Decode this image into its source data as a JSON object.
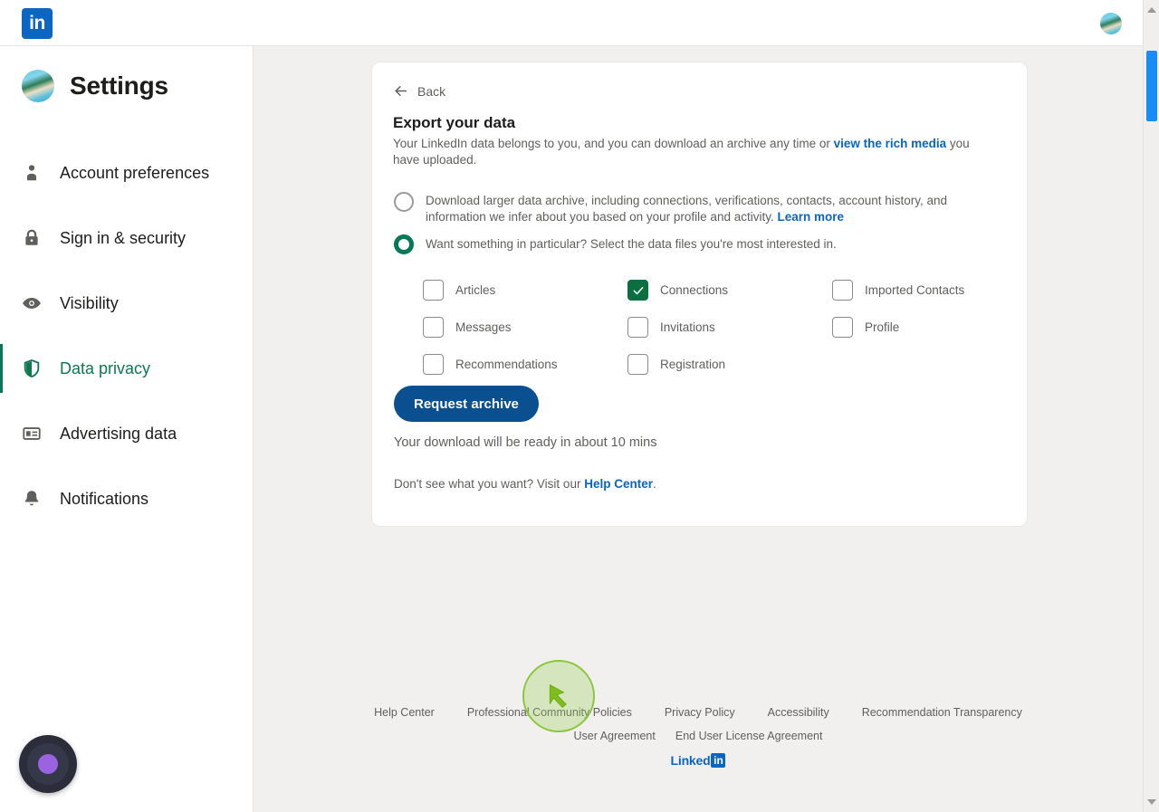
{
  "topbar": {
    "logo_text": "in",
    "logo_color": "#0a66c2",
    "avatar_name": "profile-avatar"
  },
  "sidebar": {
    "title": "Settings",
    "items": [
      {
        "label": "Account preferences",
        "icon": "person-icon",
        "active": false
      },
      {
        "label": "Sign in & security",
        "icon": "lock-icon",
        "active": false
      },
      {
        "label": "Visibility",
        "icon": "eye-icon",
        "active": false
      },
      {
        "label": "Data privacy",
        "icon": "shield-icon",
        "active": true
      },
      {
        "label": "Advertising data",
        "icon": "ad-card-icon",
        "active": false
      },
      {
        "label": "Notifications",
        "icon": "bell-icon",
        "active": false
      }
    ],
    "active_color": "#0a7a4e"
  },
  "card": {
    "back_label": "Back",
    "title": "Export your data",
    "description_part1": "Your LinkedIn data belongs to you, and you can download an archive any time or ",
    "description_link": "view the rich media",
    "description_part2": " you have uploaded.",
    "options": [
      {
        "id": "larger-archive",
        "selected": false,
        "text_part1": "Download larger data archive, including connections, verifications, contacts, account history, and information we infer about you based on your profile and activity. ",
        "link": "Learn more"
      },
      {
        "id": "specific-files",
        "selected": true,
        "text_part1": "Want something in particular? Select the data files you're most interested in.",
        "link": ""
      }
    ],
    "checkboxes": [
      {
        "label": "Articles",
        "checked": false
      },
      {
        "label": "Connections",
        "checked": true
      },
      {
        "label": "Imported Contacts",
        "checked": false
      },
      {
        "label": "Messages",
        "checked": false
      },
      {
        "label": "Invitations",
        "checked": false
      },
      {
        "label": "Profile",
        "checked": false
      },
      {
        "label": "Recommendations",
        "checked": false
      },
      {
        "label": "Registration",
        "checked": false
      }
    ],
    "request_button": "Request archive",
    "status_text": "Your download will be ready in about 10 mins",
    "help_prefix": "Don't see what you want? Visit our ",
    "help_link": "Help Center",
    "help_suffix": ".",
    "button_color": "#0a4f8f",
    "checked_color": "#0a7040"
  },
  "footer": {
    "row1": [
      "Help Center",
      "Professional Community Policies",
      "Privacy Policy",
      "Accessibility",
      "Recommendation Transparency"
    ],
    "row2": [
      "User Agreement",
      "End User License Agreement"
    ],
    "logo_word": "Linked",
    "logo_square": "in"
  },
  "overlays": {
    "click_indicator": "cursor-click-indicator",
    "recorder_widget": "screen-recorder-widget"
  },
  "scrollbar": {
    "thumb_color": "#1a8cf5"
  }
}
